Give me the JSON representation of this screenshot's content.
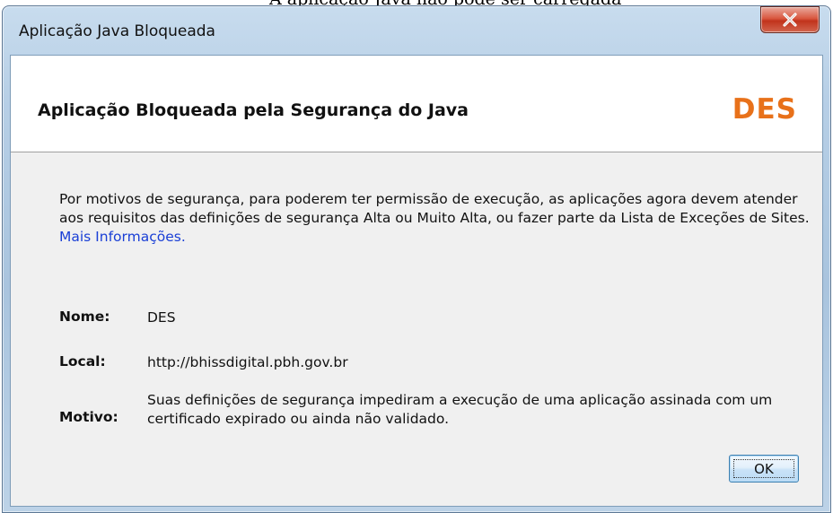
{
  "background": {
    "partial_text": "A aplicação Java não pode ser carregada"
  },
  "window": {
    "title": "Aplicação Java Bloqueada",
    "close_icon": "close-icon"
  },
  "header": {
    "title": "Aplicação Bloqueada pela Segurança do Java",
    "logo_text": "DES",
    "logo_color": "#e8711a"
  },
  "message": {
    "text": "Por motivos de segurança, para poderem ter permissão de execução, as aplicações agora devem atender aos requisitos das definições de segurança Alta ou Muito Alta, ou fazer parte da Lista de Exceções de Sites. ",
    "link_text": "Mais Informações."
  },
  "details": {
    "name_label": "Nome:",
    "name_value": "DES",
    "location_label": "Local:",
    "location_value": "http://bhissdigital.pbh.gov.br",
    "reason_label": "Motivo:",
    "reason_value": "Suas definições de segurança impediram a execução de uma aplicação assinada com um certificado expirado ou ainda não validado."
  },
  "buttons": {
    "ok_label": "OK"
  },
  "colors": {
    "link": "#1a3fd6",
    "close_button": "#c1331c",
    "dialog_background": "#f0f0f0"
  }
}
